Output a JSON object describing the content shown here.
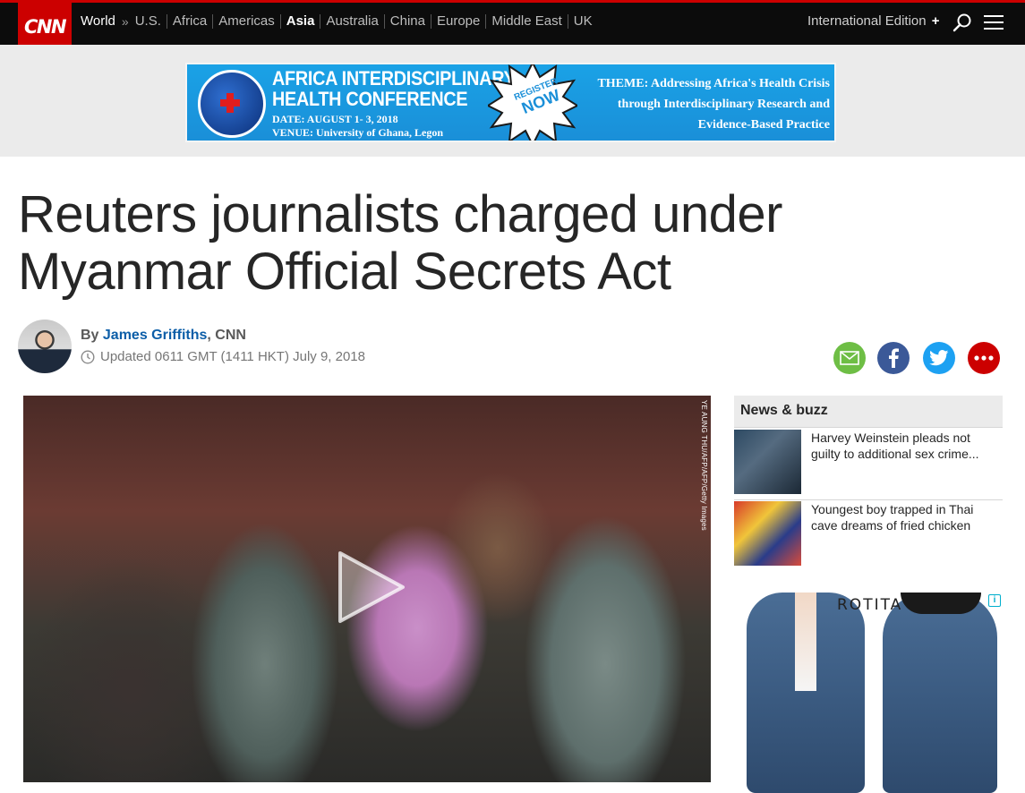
{
  "nav": {
    "logo": "CNN",
    "section": "World",
    "sep": "»",
    "links": [
      "U.S.",
      "Africa",
      "Americas",
      "Asia",
      "Australia",
      "China",
      "Europe",
      "Middle East",
      "UK"
    ],
    "active": "Asia",
    "edition": "International Edition",
    "edition_plus": "+"
  },
  "ad_banner": {
    "title_line1": "AFRICA INTERDISCIPLINARY",
    "title_line2": "HEALTH CONFERENCE",
    "date": "DATE: AUGUST 1- 3, 2018",
    "venue": "VENUE: University of Ghana, Legon",
    "star_top": "REGISTER",
    "star_bottom": "NOW",
    "theme_line1": "THEME: Addressing Africa's Health Crisis",
    "theme_line2": "through Interdisciplinary Research and",
    "theme_line3": "Evidence-Based Practice"
  },
  "article": {
    "headline_line1": "Reuters journalists charged under",
    "headline_line2": "Myanmar Official Secrets Act",
    "by": "By",
    "author": "James Griffiths",
    "source": ", CNN",
    "updated": "Updated 0611 GMT (1411 HKT) July 9, 2018",
    "photo_credit": "YE AUNG THU/AFP/AFP/Getty Images"
  },
  "sidebar": {
    "header": "News & buzz",
    "items": [
      {
        "title": "Harvey Weinstein pleads not guilty to additional sex crime..."
      },
      {
        "title": "Youngest boy trapped in Thai cave dreams of fried chicken"
      }
    ],
    "ad_brand": "ROTITA",
    "ad_info": "i"
  },
  "colors": {
    "cnn_red": "#cc0000",
    "nav_bg": "#0c0c0c",
    "author_link": "#0c5ea8"
  }
}
